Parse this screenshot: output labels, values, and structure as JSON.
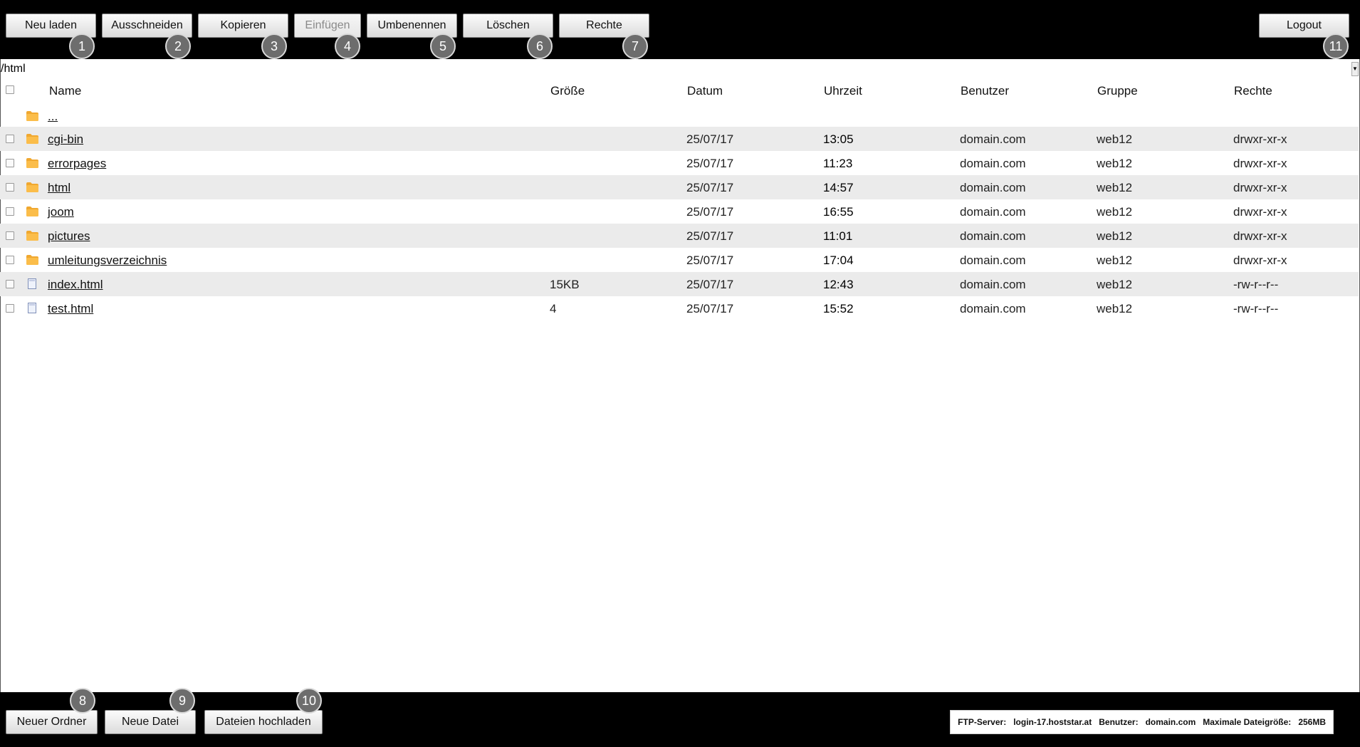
{
  "toolbar": {
    "buttons": [
      {
        "label": "Neu laden",
        "badge": "1"
      },
      {
        "label": "Ausschneiden",
        "badge": "2"
      },
      {
        "label": "Kopieren",
        "badge": "3"
      },
      {
        "label": "Einfügen",
        "badge": "4",
        "disabled": true
      },
      {
        "label": "Umbenennen",
        "badge": "5"
      },
      {
        "label": "Löschen",
        "badge": "6"
      },
      {
        "label": "Rechte",
        "badge": "7"
      }
    ],
    "logout": {
      "label": "Logout",
      "badge": "11"
    }
  },
  "path": {
    "current": "/html"
  },
  "table": {
    "headers": {
      "name": "Name",
      "size": "Größe",
      "date": "Datum",
      "time": "Uhrzeit",
      "user": "Benutzer",
      "group": "Gruppe",
      "perms": "Rechte"
    },
    "parent": {
      "name": "..."
    },
    "rows": [
      {
        "type": "folder",
        "name": "cgi-bin",
        "size": "",
        "date": "25/07/17",
        "time": "13:05",
        "user": "domain.com",
        "group": "web12",
        "perms": "drwxr-xr-x"
      },
      {
        "type": "folder",
        "name": "errorpages",
        "size": "",
        "date": "25/07/17",
        "time": "11:23",
        "user": "domain.com",
        "group": "web12",
        "perms": "drwxr-xr-x"
      },
      {
        "type": "folder",
        "name": "html",
        "size": "",
        "date": "25/07/17",
        "time": "14:57",
        "user": "domain.com",
        "group": "web12",
        "perms": "drwxr-xr-x"
      },
      {
        "type": "folder",
        "name": "joom",
        "size": "",
        "date": "25/07/17",
        "time": "16:55",
        "user": "domain.com",
        "group": "web12",
        "perms": "drwxr-xr-x"
      },
      {
        "type": "folder",
        "name": "pictures",
        "size": "",
        "date": "25/07/17",
        "time": "11:01",
        "user": "domain.com",
        "group": "web12",
        "perms": "drwxr-xr-x"
      },
      {
        "type": "folder",
        "name": "umleitungsverzeichnis",
        "size": "",
        "date": "25/07/17",
        "time": "17:04",
        "user": "domain.com",
        "group": "web12",
        "perms": "drwxr-xr-x"
      },
      {
        "type": "file",
        "name": "index.html",
        "size": "15KB",
        "date": "25/07/17",
        "time": "12:43",
        "user": "domain.com",
        "group": "web12",
        "perms": "-rw-r--r--"
      },
      {
        "type": "file",
        "name": "test.html",
        "size": "4",
        "date": "25/07/17",
        "time": "15:52",
        "user": "domain.com",
        "group": "web12",
        "perms": "-rw-r--r--"
      }
    ]
  },
  "bottom": {
    "buttons": [
      {
        "label": "Neuer Ordner",
        "badge": "8"
      },
      {
        "label": "Neue Datei",
        "badge": "9"
      },
      {
        "label": "Dateien hochladen",
        "badge": "10"
      }
    ],
    "info": {
      "server_label": "FTP-Server:",
      "server": "login-17.hoststar.at",
      "user_label": "Benutzer:",
      "user": "domain.com",
      "maxsize_label": "Maximale Dateigröße:",
      "maxsize": "256MB"
    }
  },
  "colors": {
    "bar": "#000000",
    "row_alt": "#ebebeb",
    "folder": "#f0a830",
    "file": "#7f8fb8",
    "badge": "#6d6d6d"
  },
  "icons": {
    "folder": "folder-icon",
    "file": "file-icon"
  }
}
